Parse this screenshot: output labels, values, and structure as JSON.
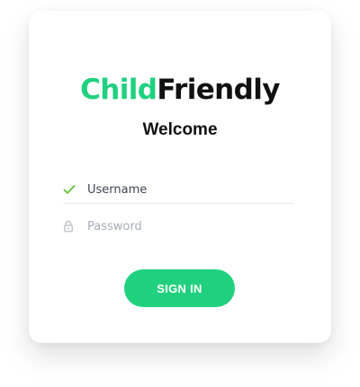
{
  "logo": {
    "part1": "Child",
    "part2": "Friendly"
  },
  "header": {
    "title": "Welcome"
  },
  "form": {
    "username_placeholder": "Username",
    "username_value": "",
    "username_icon": "check-icon",
    "password_placeholder": "Password",
    "password_value": "",
    "password_icon": "lock-icon",
    "submit_label": "SIGN IN"
  },
  "colors": {
    "brand": "#1fd17f",
    "text_dark": "#111111",
    "placeholder": "#a6adb7",
    "check": "#5fc43a"
  }
}
